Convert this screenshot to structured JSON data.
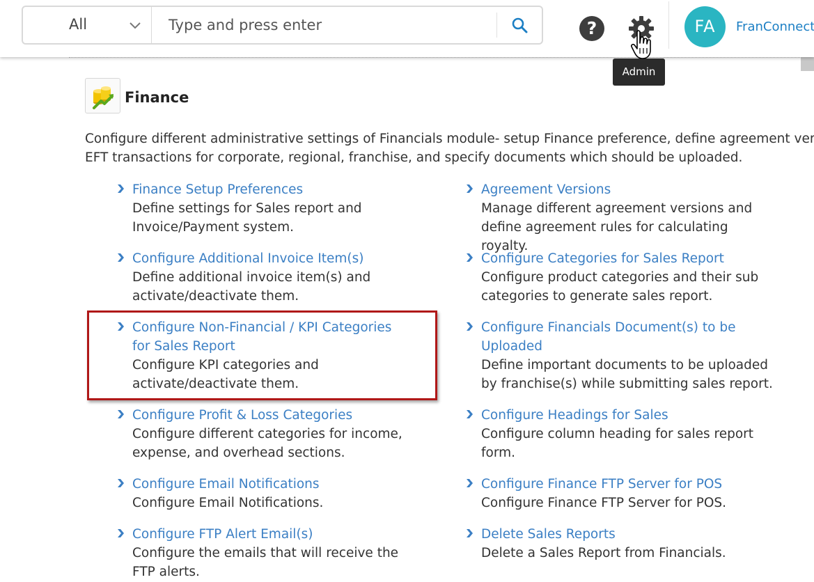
{
  "header": {
    "search": {
      "scope_label": "All",
      "placeholder": "Type and press enter"
    },
    "help_icon": "question-circle-icon",
    "settings_icon": "gear-icon",
    "avatar_initials": "FA",
    "user_name": "FranConnect",
    "tooltip": "Admin"
  },
  "page": {
    "title": "Finance",
    "description_line1": "Configure different administrative settings of Financials module- setup Finance preference, define agreement versions, e",
    "description_line2": "EFT transactions for corporate, regional, franchise, and specify documents which should be uploaded."
  },
  "items_left": [
    {
      "link": "Finance Setup Preferences",
      "desc": "Define settings for Sales report and Invoice/Payment system."
    },
    {
      "link": "Configure Additional Invoice Item(s)",
      "desc": "Define additional invoice item(s) and activate/deactivate them."
    },
    {
      "link": "Configure Non-Financial / KPI Categories for Sales Report",
      "desc": "Configure KPI categories and activate/deactivate them."
    },
    {
      "link": "Configure Profit & Loss Categories",
      "desc": "Configure different categories for income, expense, and overhead sections."
    },
    {
      "link": "Configure Email Notifications",
      "desc": "Configure Email Notifications."
    },
    {
      "link": "Configure FTP Alert Email(s)",
      "desc": "Configure the emails that will receive the FTP alerts."
    }
  ],
  "items_right": [
    {
      "link": "Agreement Versions",
      "desc": "Manage different agreement versions and define agreement rules for calculating royalty."
    },
    {
      "link": "Configure Categories for Sales Report",
      "desc": "Configure product categories and their sub categories to generate sales report."
    },
    {
      "link": "Configure Financials Document(s) to be Uploaded",
      "desc": "Define important documents to be uploaded by franchise(s) while submitting sales report."
    },
    {
      "link": "Configure Headings for Sales",
      "desc": "Configure column heading for sales report form."
    },
    {
      "link": "Configure Finance FTP Server for POS",
      "desc": "Configure Finance FTP Server for POS."
    },
    {
      "link": "Delete Sales Reports",
      "desc": "Delete a Sales Report from Financials."
    }
  ],
  "colors": {
    "link": "#3b7fc4",
    "highlight_border": "#b01818",
    "avatar_bg": "#2ab5c2",
    "search_icon": "#1c7fc4"
  }
}
